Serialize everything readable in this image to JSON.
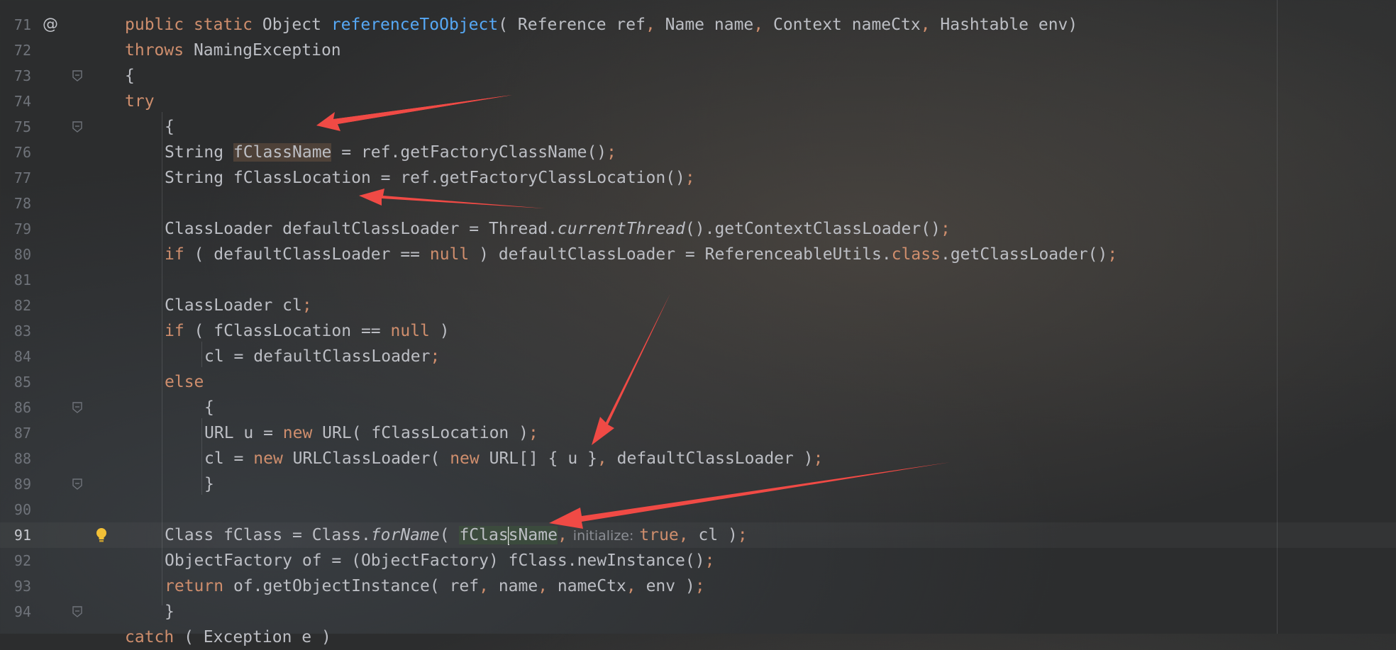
{
  "editor": {
    "lines": [
      {
        "num": "71",
        "marker": "@",
        "tokens": [
          [
            "kw",
            "public "
          ],
          [
            "kw",
            "static "
          ],
          [
            "p",
            "Object "
          ],
          [
            "fn",
            "referenceToObject"
          ],
          [
            "p",
            "( Reference ref"
          ],
          [
            "sep",
            ", "
          ],
          [
            "p",
            "Name name"
          ],
          [
            "sep",
            ", "
          ],
          [
            "p",
            "Context nameCtx"
          ],
          [
            "sep",
            ", "
          ],
          [
            "p",
            "Hashtable env)"
          ]
        ]
      },
      {
        "num": "72",
        "tokens": [
          [
            "kw",
            "throws "
          ],
          [
            "p",
            "NamingException"
          ]
        ]
      },
      {
        "num": "73",
        "fold": true,
        "tokens": [
          [
            "p",
            "{"
          ]
        ]
      },
      {
        "num": "74",
        "tokens": [
          [
            "kw",
            "try"
          ]
        ]
      },
      {
        "num": "75",
        "fold": true,
        "tokens": [
          [
            "p",
            "{"
          ]
        ]
      },
      {
        "num": "76",
        "tokens": [
          [
            "p",
            "String "
          ],
          [
            "hlr",
            "fClassName"
          ],
          [
            "p",
            " = ref.getFactoryClassName()"
          ],
          [
            "sep",
            ";"
          ]
        ]
      },
      {
        "num": "77",
        "tokens": [
          [
            "p",
            "String fClassLocation = ref.getFactoryClassLocation()"
          ],
          [
            "sep",
            ";"
          ]
        ]
      },
      {
        "num": "78",
        "tokens": []
      },
      {
        "num": "79",
        "tokens": [
          [
            "p",
            "ClassLoader defaultClassLoader = Thread."
          ],
          [
            "it",
            "currentThread"
          ],
          [
            "p",
            "().getContextClassLoader()"
          ],
          [
            "sep",
            ";"
          ]
        ]
      },
      {
        "num": "80",
        "tokens": [
          [
            "kw",
            "if "
          ],
          [
            "p",
            "( defaultClassLoader == "
          ],
          [
            "kw",
            "null"
          ],
          [
            "p",
            " ) defaultClassLoader = ReferenceableUtils."
          ],
          [
            "kw",
            "class"
          ],
          [
            "p",
            ".getClassLoader()"
          ],
          [
            "sep",
            ";"
          ]
        ]
      },
      {
        "num": "81",
        "tokens": []
      },
      {
        "num": "82",
        "tokens": [
          [
            "p",
            "ClassLoader cl"
          ],
          [
            "sep",
            ";"
          ]
        ]
      },
      {
        "num": "83",
        "tokens": [
          [
            "kw",
            "if "
          ],
          [
            "p",
            "( fClassLocation == "
          ],
          [
            "kw",
            "null"
          ],
          [
            "p",
            " )"
          ]
        ]
      },
      {
        "num": "84",
        "tokens": [
          [
            "p",
            "cl = defaultClassLoader"
          ],
          [
            "sep",
            ";"
          ]
        ]
      },
      {
        "num": "85",
        "tokens": [
          [
            "kw",
            "else"
          ]
        ]
      },
      {
        "num": "86",
        "fold": true,
        "tokens": [
          [
            "p",
            "{"
          ]
        ]
      },
      {
        "num": "87",
        "tokens": [
          [
            "p",
            "URL u = "
          ],
          [
            "kw",
            "new "
          ],
          [
            "p",
            "URL( fClassLocation )"
          ],
          [
            "sep",
            ";"
          ]
        ]
      },
      {
        "num": "88",
        "tokens": [
          [
            "p",
            "cl = "
          ],
          [
            "kw",
            "new "
          ],
          [
            "p",
            "URLClassLoader( "
          ],
          [
            "kw",
            "new "
          ],
          [
            "p",
            "URL[] { u }"
          ],
          [
            "sep",
            ", "
          ],
          [
            "p",
            "defaultClassLoader )"
          ],
          [
            "sep",
            ";"
          ]
        ]
      },
      {
        "num": "89",
        "fold": true,
        "tokens": [
          [
            "p",
            "}"
          ]
        ]
      },
      {
        "num": "90",
        "tokens": []
      },
      {
        "num": "91",
        "current": true,
        "bulb": true,
        "tokens": [
          [
            "p",
            "Class fClass = Class."
          ],
          [
            "it",
            "forName"
          ],
          [
            "p",
            "( "
          ],
          [
            "hlw1",
            "fClas"
          ],
          [
            "caret",
            ""
          ],
          [
            "hlw2",
            "sName"
          ],
          [
            "sep",
            ","
          ],
          [
            "hint",
            "initialize:"
          ],
          [
            "kw",
            "true"
          ],
          [
            "sep",
            ", "
          ],
          [
            "p",
            "cl )"
          ],
          [
            "sep",
            ";"
          ]
        ]
      },
      {
        "num": "92",
        "tokens": [
          [
            "p",
            "ObjectFactory of = (ObjectFactory) fClass.newInstance()"
          ],
          [
            "sep",
            ";"
          ]
        ]
      },
      {
        "num": "93",
        "tokens": [
          [
            "kw",
            "return "
          ],
          [
            "p",
            "of.getObjectInstance( ref"
          ],
          [
            "sep",
            ", "
          ],
          [
            "p",
            "name"
          ],
          [
            "sep",
            ", "
          ],
          [
            "p",
            "nameCtx"
          ],
          [
            "sep",
            ", "
          ],
          [
            "p",
            "env )"
          ],
          [
            "sep",
            ";"
          ]
        ]
      },
      {
        "num": "94",
        "fold": true,
        "tokens": [
          [
            "p",
            "}"
          ]
        ]
      }
    ],
    "partial_line_tokens": [
      [
        "kw",
        "catch "
      ],
      [
        "p",
        "( Exception e )"
      ]
    ]
  },
  "colors": {
    "keyword": "#cf8e6d",
    "function": "#56a8f5",
    "plain": "#bcbec4",
    "arrow": "#f04a45",
    "line_number": "#6f737a"
  },
  "icons": {
    "gutter_marker": "override-marker-icon",
    "fold": "fold-toggle-icon",
    "bulb": "lightbulb-icon"
  }
}
